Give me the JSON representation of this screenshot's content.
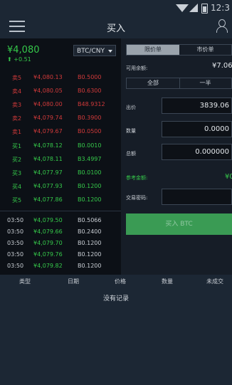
{
  "status_bar": {
    "time": "12:3"
  },
  "header": {
    "title": "买入"
  },
  "ticker": {
    "price": "¥4,080",
    "change": "⬆ +0.51",
    "pair": "BTC/CNY"
  },
  "asks": [
    {
      "label": "卖5",
      "price": "¥4,080.13",
      "amount": "B0.5000"
    },
    {
      "label": "卖4",
      "price": "¥4,080.05",
      "amount": "B0.6300"
    },
    {
      "label": "卖3",
      "price": "¥4,080.00",
      "amount": "B48.9312"
    },
    {
      "label": "卖2",
      "price": "¥4,079.74",
      "amount": "B0.3900"
    },
    {
      "label": "卖1",
      "price": "¥4,079.67",
      "amount": "B0.0500"
    }
  ],
  "bids": [
    {
      "label": "买1",
      "price": "¥4,078.12",
      "amount": "B0.0010"
    },
    {
      "label": "买2",
      "price": "¥4,078.11",
      "amount": "B3.4997"
    },
    {
      "label": "买3",
      "price": "¥4,077.97",
      "amount": "B0.0100"
    },
    {
      "label": "买4",
      "price": "¥4,077.93",
      "amount": "B0.1200"
    },
    {
      "label": "买5",
      "price": "¥4,077.86",
      "amount": "B0.1200"
    }
  ],
  "trades": [
    {
      "time": "03:50",
      "price": "¥4,079.50",
      "amount": "B0.5066"
    },
    {
      "time": "03:50",
      "price": "¥4,079.66",
      "amount": "B0.2400"
    },
    {
      "time": "03:50",
      "price": "¥4,079.70",
      "amount": "B0.1200"
    },
    {
      "time": "03:50",
      "price": "¥4,079.76",
      "amount": "B0.1200"
    },
    {
      "time": "03:50",
      "price": "¥4,079.82",
      "amount": "B0.1200"
    }
  ],
  "order_form": {
    "tab_limit": "限价单",
    "tab_market": "市价单",
    "available_label": "可用余额:",
    "available_value": "¥7.06",
    "pct_all": "全部",
    "pct_half": "一半",
    "price_label": "出价",
    "price_value": "3839.06",
    "amount_label": "数量",
    "amount_value": "0.0000",
    "total_label": "总额",
    "total_value": "0.000000",
    "estimate_label": "参考金额:",
    "estimate_value": "¥0",
    "password_label": "交易密码:",
    "password_value": "",
    "buy_button": "买入 BTC"
  },
  "orders_header": {
    "type": "类型",
    "date": "日期",
    "price": "价格",
    "amount": "数量",
    "unfilled": "未成交"
  },
  "orders_empty": "没有记录",
  "colors": {
    "sell": "#d23a3a",
    "buy": "#35c84a",
    "button": "#3a9b54",
    "panel": "#161d27",
    "bar": "#1c2734"
  }
}
